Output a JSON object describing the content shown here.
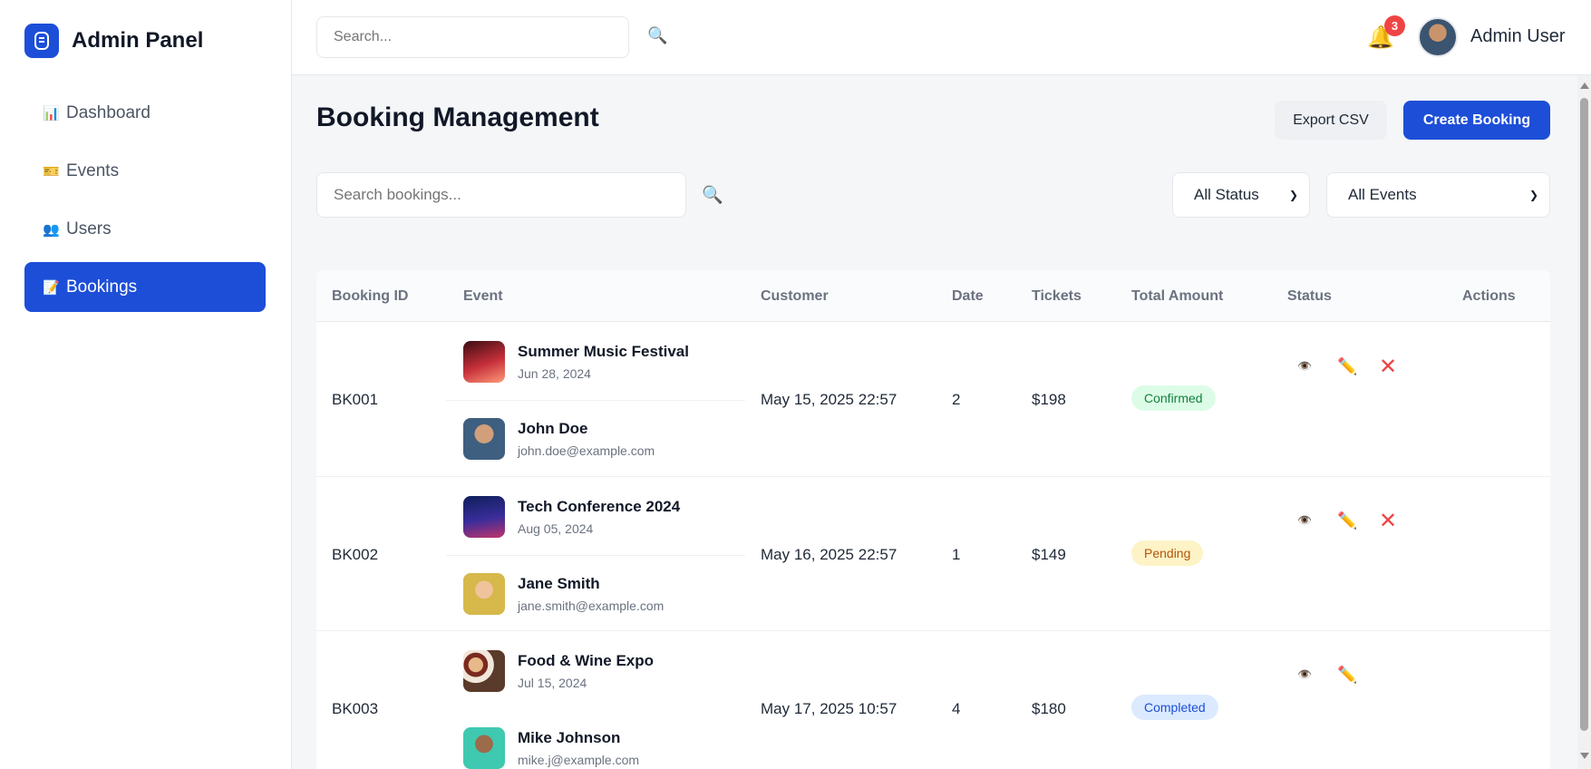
{
  "sidebar": {
    "brand": "Admin Panel",
    "items": [
      {
        "label": "Dashboard",
        "icon": "bar-chart-icon"
      },
      {
        "label": "Events",
        "icon": "ticket-icon"
      },
      {
        "label": "Users",
        "icon": "users-icon"
      },
      {
        "label": "Bookings",
        "icon": "document-icon",
        "active": true
      }
    ]
  },
  "topbar": {
    "search_placeholder": "Search...",
    "notification_count": "3",
    "user_name": "Admin User"
  },
  "page": {
    "title": "Booking Management",
    "export_label": "Export CSV",
    "create_label": "Create Booking",
    "search_placeholder": "Search bookings...",
    "status_filter": "All Status",
    "event_filter": "All Events"
  },
  "table": {
    "columns": [
      "Booking ID",
      "Event",
      "Customer",
      "Date",
      "Tickets",
      "Total Amount",
      "Status",
      "Actions"
    ],
    "rows": [
      {
        "id": "BK001",
        "event_name": "Summer Music Festival",
        "event_date": "Jun 28, 2024",
        "customer_name": "John Doe",
        "customer_email": "john.doe@example.com",
        "date": "May 15, 2025 22:57",
        "tickets": "2",
        "amount": "$198",
        "status": "Confirmed"
      },
      {
        "id": "BK002",
        "event_name": "Tech Conference 2024",
        "event_date": "Aug 05, 2024",
        "customer_name": "Jane Smith",
        "customer_email": "jane.smith@example.com",
        "date": "May 16, 2025 22:57",
        "tickets": "1",
        "amount": "$149",
        "status": "Pending"
      },
      {
        "id": "BK003",
        "event_name": "Food & Wine Expo",
        "event_date": "Jul 15, 2024",
        "customer_name": "Mike Johnson",
        "customer_email": "mike.j@example.com",
        "date": "May 17, 2025 10:57",
        "tickets": "4",
        "amount": "$180",
        "status": "Completed"
      }
    ]
  },
  "colors": {
    "primary": "#1d4ed8",
    "confirmed_bg": "#dcfce7",
    "confirmed_fg": "#15803d",
    "pending_bg": "#fef3c7",
    "pending_fg": "#b45309",
    "completed_bg": "#dbeafe",
    "completed_fg": "#1d4ed8"
  },
  "icons": {
    "view": "eye-icon",
    "edit": "pencil-icon",
    "delete": "x-icon",
    "search": "magnifier-icon",
    "bell": "bell-icon"
  }
}
